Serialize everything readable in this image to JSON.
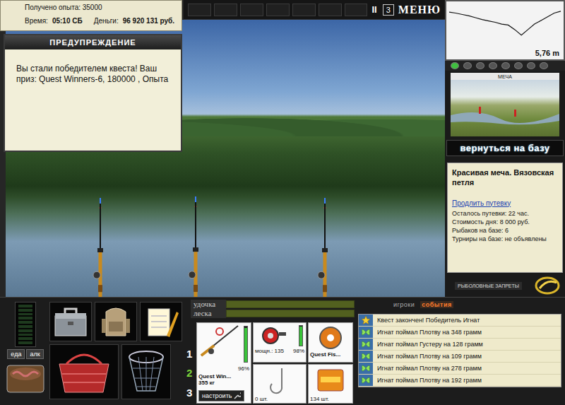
{
  "hud": {
    "experience": "Получено опыта: 35000",
    "time_label": "Время:",
    "time": "05:10 СБ",
    "money_label": "Деньги:",
    "money": "96 920 131 руб."
  },
  "top_bar": {
    "pause": "II",
    "speed": "3",
    "menu": "МЕНЮ"
  },
  "warning": {
    "title": "ПРЕДУПРЕЖДЕНИЕ",
    "message": "Вы стали победителем квеста! Ваш приз: Quest Winners-6, 180000 , Опыта"
  },
  "depth": {
    "reading": "5,76 m",
    "profile": [
      0.8,
      1.0,
      1.3,
      1.6,
      2.0,
      2.4,
      2.7,
      3.0,
      3.4,
      3.6,
      4.6,
      5.8,
      4.6,
      3.4,
      2.6,
      1.8,
      1.0,
      0.6
    ]
  },
  "location": {
    "caption": "МЕЧА",
    "return_button": "вернуться на базу",
    "name": "Красивая меча. Вязовская петля",
    "extend_link": "Продлить путевку",
    "details": [
      "Осталось путевки: 22 час.",
      "Стоимость дня: 8 000 руб.",
      "Рыбаков на базе: 6",
      "Турниры на базе: не объявлены"
    ],
    "bans_button": "РЫБОЛОВНЫЕ ЗАПРЕТЫ"
  },
  "toolbar": {
    "bite_meter": {
      "level": 0
    },
    "food": "еда",
    "alcohol": "алк",
    "slots": [
      {
        "label": "1",
        "selected": false
      },
      {
        "label": "2",
        "selected": true
      },
      {
        "label": "3",
        "selected": false
      }
    ]
  },
  "tension": [
    {
      "label": "удочка",
      "level": 0
    },
    {
      "label": "леска",
      "level": 0
    }
  ],
  "tackle": {
    "rod": {
      "name": "Quest Win...",
      "load": "355 кг",
      "condition": "96%",
      "level": 0.96
    },
    "configure_button": "настроить",
    "reel": {
      "power": "мощн.: 135",
      "condition": "98%",
      "level": 0.98
    },
    "line": {
      "name": "Quest Fis..."
    },
    "hook": {
      "count": "0 шт."
    },
    "bait": {
      "count": "134 шт."
    }
  },
  "events_panel": {
    "tabs": [
      {
        "label": "игроки",
        "selected": false
      },
      {
        "label": "события",
        "selected": true
      }
    ],
    "events": [
      {
        "kind": "quest",
        "text": "Квест закончен! Победитель Игнат"
      },
      {
        "kind": "catch",
        "text": "Игнат поймал Плотву на 348 грамм"
      },
      {
        "kind": "catch",
        "text": "Игнат поймал Густеру на 128 грамм"
      },
      {
        "kind": "catch",
        "text": "Игнат поймал Плотву на 109 грамм"
      },
      {
        "kind": "catch",
        "text": "Игнат поймал Плотву на 278 грамм"
      },
      {
        "kind": "catch",
        "text": "Игнат поймал Плотву на 192 грамм"
      }
    ]
  }
}
